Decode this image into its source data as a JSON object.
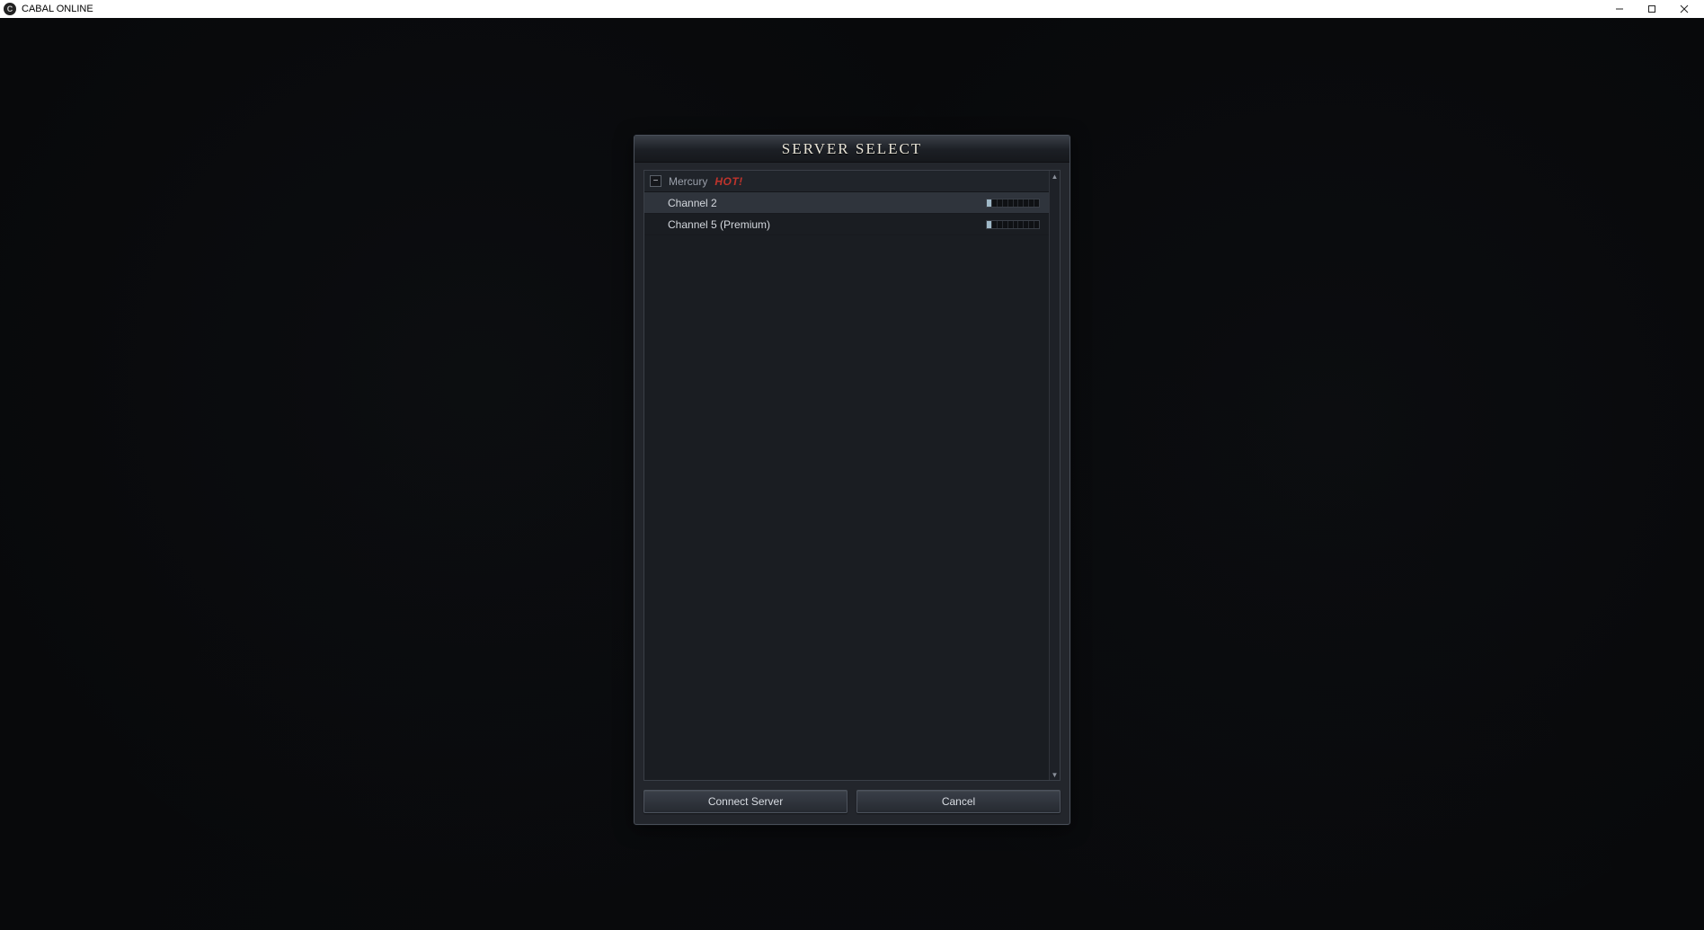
{
  "window": {
    "title": "CABAL ONLINE"
  },
  "dialog": {
    "title": "SERVER SELECT",
    "server": {
      "name": "Mercury",
      "badge": "HOT!",
      "expanded": true
    },
    "channels": [
      {
        "name": "Channel 2",
        "selected": true,
        "load_segments_filled": 1,
        "load_segments_total": 10
      },
      {
        "name": "Channel 5 (Premium)",
        "selected": false,
        "load_segments_filled": 1,
        "load_segments_total": 10
      }
    ],
    "buttons": {
      "connect": "Connect Server",
      "cancel": "Cancel"
    }
  }
}
